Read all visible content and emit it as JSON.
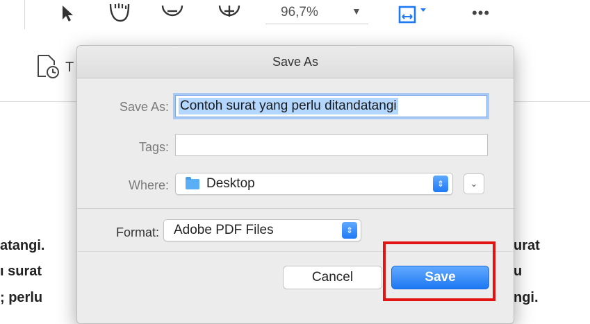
{
  "toolbar": {
    "zoom_value": "96,7%",
    "tools": [
      "select-arrow",
      "hand",
      "zoom-out",
      "zoom-in",
      "fit-page",
      "more"
    ]
  },
  "subtoolbar": {
    "label_partial": "T"
  },
  "document": {
    "left_lines": [
      "atangi.",
      "ı surat",
      "; perlu"
    ],
    "right_lines": [
      "urat",
      "u",
      "ngi."
    ]
  },
  "dialog": {
    "title": "Save As",
    "save_as_label": "Save As:",
    "filename": "Contoh surat yang perlu ditandatangi",
    "tags_label": "Tags:",
    "tags_value": "",
    "where_label": "Where:",
    "where_value": "Desktop",
    "format_label": "Format:",
    "format_value": "Adobe PDF Files",
    "cancel_label": "Cancel",
    "save_label": "Save"
  },
  "colors": {
    "accent": "#1d78f2",
    "highlight": "#e21313",
    "selection": "#b3d7ff"
  }
}
